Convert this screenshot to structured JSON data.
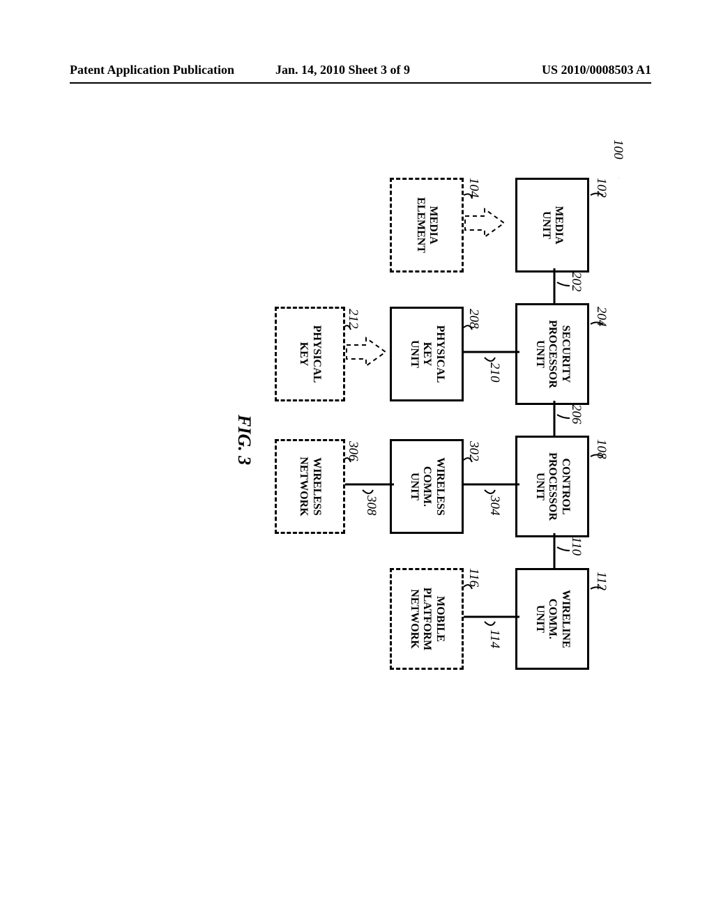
{
  "header": {
    "left": "Patent Application Publication",
    "center": "Jan. 14, 2010   Sheet 3 of 9",
    "right": "US 2010/0008503 A1"
  },
  "fig": {
    "label": "FIG. 3"
  },
  "refs": {
    "r100": "100",
    "r102": "102",
    "r104": "104",
    "r108": "108",
    "r110": "110",
    "r112": "112",
    "r114": "114",
    "r116": "116",
    "r202": "202",
    "r204": "204",
    "r206": "206",
    "r208": "208",
    "r210": "210",
    "r212": "212",
    "r302": "302",
    "r304": "304",
    "r306": "306",
    "r308": "308"
  },
  "boxes": {
    "media_unit": "MEDIA\nUNIT",
    "media_element": "MEDIA\nELEMENT",
    "security_proc": "SECURITY\nPROCESSOR\nUNIT",
    "physical_key_unit": "PHYSICAL\nKEY\nUNIT",
    "physical_key": "PHYSICAL\nKEY",
    "control_proc": "CONTROL\nPROCESSOR\nUNIT",
    "wireless_comm": "WIRELESS\nCOMM.\nUNIT",
    "wireless_net": "WIRELESS\nNETWORK",
    "wireline_comm": "WIRELINE\nCOMM.\nUNIT",
    "mobile_platform": "MOBILE\nPLATFORM\nNETWORK"
  }
}
